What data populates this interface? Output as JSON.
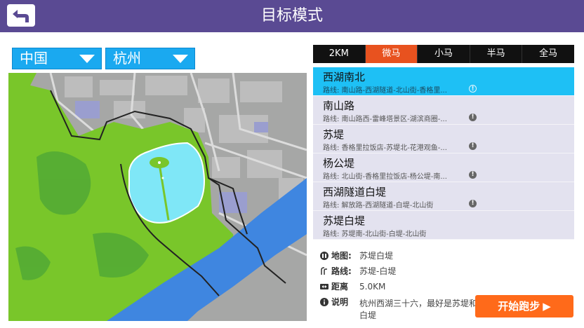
{
  "header": {
    "title": "目标模式"
  },
  "location": {
    "country": "中国",
    "city": "杭州"
  },
  "tabs": [
    {
      "label": "2KM",
      "active": false
    },
    {
      "label": "微马",
      "active": true
    },
    {
      "label": "小马",
      "active": false
    },
    {
      "label": "半马",
      "active": false
    },
    {
      "label": "全马",
      "active": false
    }
  ],
  "routes": [
    {
      "name": "西湖南北",
      "sub": "路线: 南山路-西湖隧道-北山街-香格里...",
      "selected": true
    },
    {
      "name": "南山路",
      "sub": "路线: 南山路西-雷峰塔景区-湖滨商圈-...",
      "selected": false
    },
    {
      "name": "苏堤",
      "sub": "路线: 香格里拉饭店-苏堤北-花港观鱼-...",
      "selected": false
    },
    {
      "name": "杨公堤",
      "sub": "路线: 北山街-香格里拉饭店-杨公堤-南...",
      "selected": false
    },
    {
      "name": "西湖隧道白堤",
      "sub": "路线: 解放路-西湖隧道-白堤-北山街",
      "selected": false
    },
    {
      "name": "苏堤白堤",
      "sub": "路线: 苏堤南-北山街-白堤-北山街",
      "selected": false
    }
  ],
  "details": {
    "map_label": "地图:",
    "map_value": "苏堤白堤",
    "route_label": "路线:",
    "route_value": "苏堤-白堤",
    "distance_label": "距离",
    "distance_value": "5.0KM",
    "desc_label": "说明",
    "desc_value": "杭州西湖三十六，最好是苏堤和白堤"
  },
  "start_button": {
    "label": "开始跑步"
  },
  "colors": {
    "header": "#5a4a93",
    "accent_blue": "#1aa9f0",
    "active_tab": "#e8521f",
    "selected_row": "#1ec0f5",
    "start_button": "#ff6a1a",
    "lake": "#7fe7f7",
    "river": "#3f86e0",
    "green": "#79c62a"
  },
  "icons": {
    "back": "back-arrow-icon",
    "dropdown": "chevron-down-icon",
    "info": "info-icon",
    "map": "map-icon",
    "route": "route-icon",
    "distance": "distance-icon",
    "play": "play-icon"
  }
}
